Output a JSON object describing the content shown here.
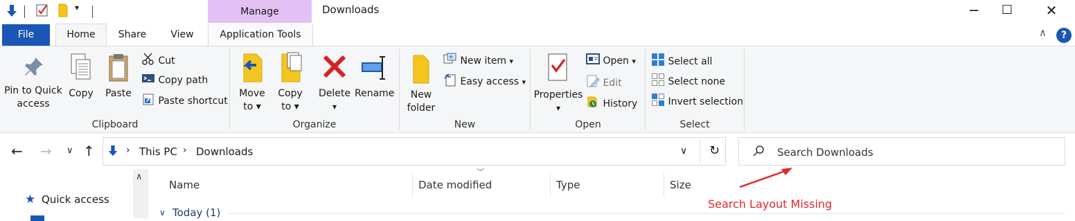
{
  "window": {
    "title": "Downloads",
    "contextual_tab_header": "Manage",
    "controls": {
      "minimize": "─",
      "maximize": "☐",
      "close": "✕"
    }
  },
  "tabs": {
    "file": "File",
    "home": "Home",
    "share": "Share",
    "view": "View",
    "application_tools": "Application Tools"
  },
  "ribbon": {
    "clipboard": {
      "label": "Clipboard",
      "pin_line1": "Pin to Quick",
      "pin_line2": "access",
      "copy": "Copy",
      "paste": "Paste",
      "cut": "Cut",
      "copy_path": "Copy path",
      "paste_shortcut": "Paste shortcut"
    },
    "organize": {
      "label": "Organize",
      "move_line1": "Move",
      "move_line2": "to",
      "copy_line1": "Copy",
      "copy_line2": "to",
      "delete": "Delete",
      "rename": "Rename"
    },
    "new": {
      "label": "New",
      "folder_line1": "New",
      "folder_line2": "folder",
      "new_item": "New item",
      "easy_access": "Easy access"
    },
    "open": {
      "label": "Open",
      "properties": "Properties",
      "open": "Open",
      "edit": "Edit",
      "history": "History"
    },
    "select": {
      "label": "Select",
      "select_all": "Select all",
      "select_none": "Select none",
      "invert_selection": "Invert selection"
    }
  },
  "address": {
    "crumbs": [
      "This PC",
      "Downloads"
    ],
    "search_placeholder": "Search Downloads"
  },
  "nav_pane": {
    "quick_access": "Quick access"
  },
  "columns": [
    "Name",
    "Date modified",
    "Type",
    "Size"
  ],
  "group_header": "Today (1)",
  "annotation": {
    "text": "Search Layout Missing",
    "color": "#e32727"
  },
  "colors": {
    "accent": "#1a57b5",
    "contextual_tab": "#e3c1f4",
    "ribbon_bg": "#f5f6f7"
  }
}
